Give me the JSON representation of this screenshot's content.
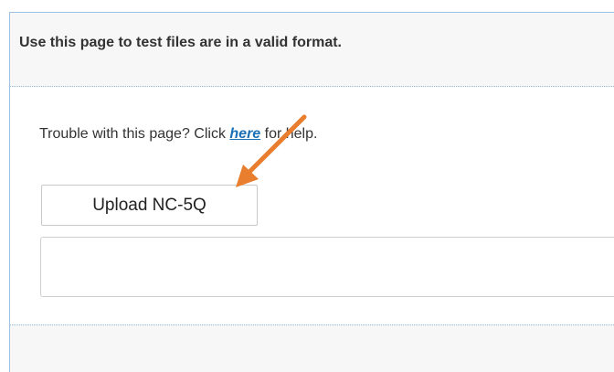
{
  "header": {
    "text": "Use this page to test files are in a valid format."
  },
  "help": {
    "prefix": "Trouble with this page? Click ",
    "link_text": "here",
    "suffix": " for help."
  },
  "upload": {
    "button_label": "Upload NC-5Q"
  },
  "result": {
    "value": ""
  },
  "annotation": {
    "arrow_color": "#e87e2e"
  },
  "colors": {
    "panel_border": "#9fc2e3",
    "link": "#1a6fb5",
    "header_bg": "#f7f7f7"
  }
}
